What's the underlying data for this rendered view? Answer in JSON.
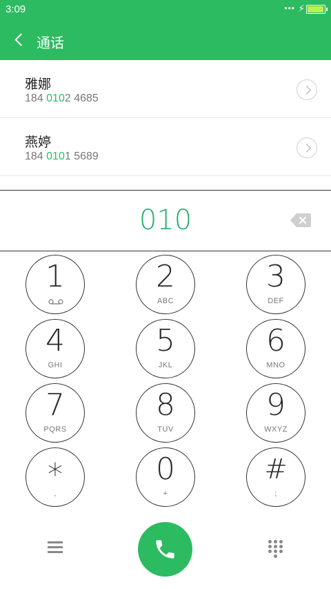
{
  "status_bar": {
    "time": "3:09",
    "signal": "•••",
    "charging_icon": "bolt-icon",
    "battery_level": 0.9,
    "battery_color": "#b9f24c"
  },
  "header": {
    "title": "通话",
    "back_icon": "chevron-left-icon",
    "background": "#2dbb61"
  },
  "contacts": [
    {
      "name": "雅娜",
      "number_prefix": "184 ",
      "number_match": "010",
      "number_suffix": "2 4685"
    },
    {
      "name": "燕婷",
      "number_prefix": "184 ",
      "number_match": "010",
      "number_suffix": "1 5689"
    }
  ],
  "dial_display": {
    "digits": "010",
    "backspace_icon": "backspace-icon",
    "color": "#22b06b"
  },
  "keypad": {
    "keys": [
      {
        "digit": "1",
        "letters": ""
      },
      {
        "digit": "2",
        "letters": "ABC"
      },
      {
        "digit": "3",
        "letters": "DEF"
      },
      {
        "digit": "4",
        "letters": "GHI"
      },
      {
        "digit": "5",
        "letters": "JKL"
      },
      {
        "digit": "6",
        "letters": "MNO"
      },
      {
        "digit": "7",
        "letters": "PQRS"
      },
      {
        "digit": "8",
        "letters": "TUV"
      },
      {
        "digit": "9",
        "letters": "WXYZ"
      },
      {
        "digit": "*",
        "letters": ","
      },
      {
        "digit": "0",
        "letters": "+"
      },
      {
        "digit": "#",
        "letters": ";"
      }
    ]
  },
  "bottom_bar": {
    "left_icon": "menu-icon",
    "call_icon": "phone-icon",
    "right_icon": "dialpad-icon",
    "call_color": "#2dbb61"
  }
}
